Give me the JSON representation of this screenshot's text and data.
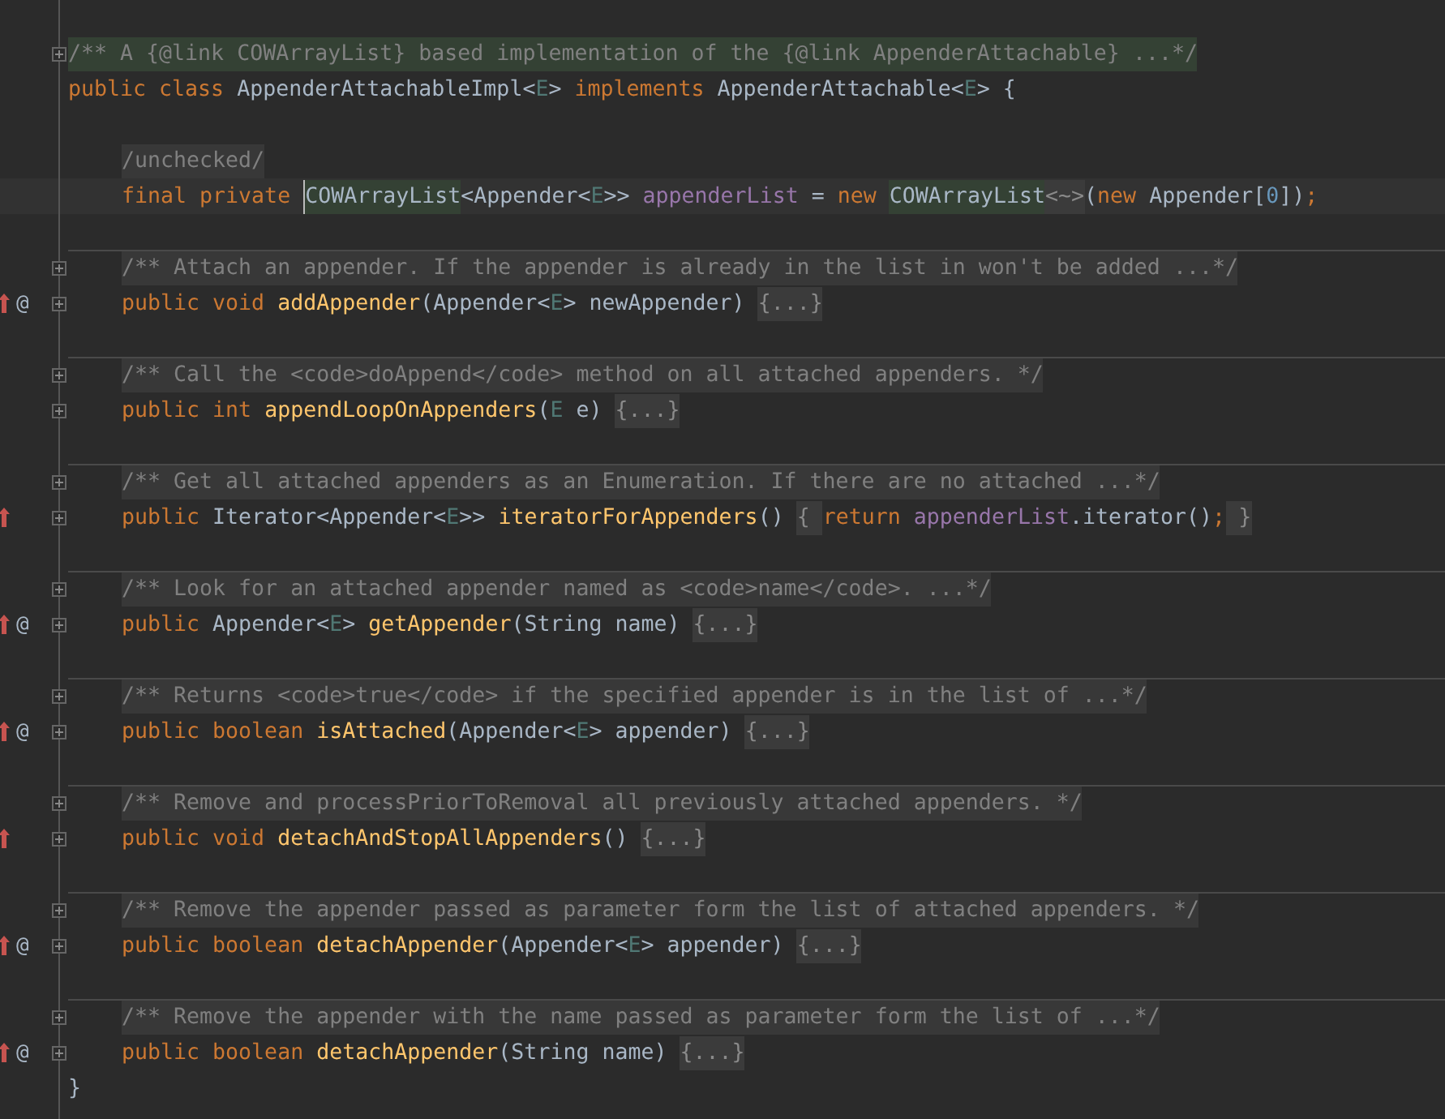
{
  "editor": {
    "lines": [
      {
        "space_before": true,
        "foldable": true,
        "tokens": [
          {
            "text": "/** A {@link COWArrayList} based implementation of the {@link AppenderAttachable} ...*/",
            "kind": "comment",
            "highlight": true
          }
        ]
      },
      {
        "tokens": [
          {
            "text": "public class ",
            "kind": "kw"
          },
          {
            "text": "AppenderAttachableImpl<",
            "kind": "plain"
          },
          {
            "text": "E",
            "kind": "tparam"
          },
          {
            "text": "> ",
            "kind": "plain"
          },
          {
            "text": "implements ",
            "kind": "kw"
          },
          {
            "text": "AppenderAttachable<",
            "kind": "plain"
          },
          {
            "text": "E",
            "kind": "tparam"
          },
          {
            "text": "> {",
            "kind": "plain"
          }
        ],
        "children": [
          {
            "space_before": true,
            "tokens": [
              {
                "text": "/unchecked/",
                "kind": "comment"
              }
            ]
          },
          {
            "current": true,
            "tokens": [
              {
                "text": "final private ",
                "kind": "kw"
              },
              {
                "text": "COWArrayList",
                "kind": "plain",
                "highlight": true,
                "caret": true
              },
              {
                "text": "<Appender<",
                "kind": "plain"
              },
              {
                "text": "E",
                "kind": "tparam"
              },
              {
                "text": ">> ",
                "kind": "plain"
              },
              {
                "text": "appenderList",
                "kind": "field"
              },
              {
                "text": " = ",
                "kind": "plain"
              },
              {
                "text": "new ",
                "kind": "kw"
              },
              {
                "text": "COWArrayList",
                "kind": "plain",
                "highlight": true
              },
              {
                "text": "<~>",
                "kind": "fold"
              },
              {
                "text": "(",
                "kind": "plain"
              },
              {
                "text": "new ",
                "kind": "kw"
              },
              {
                "text": "Appender[",
                "kind": "plain"
              },
              {
                "text": "0",
                "kind": "num"
              },
              {
                "text": "])",
                "kind": "plain"
              },
              {
                "text": ";",
                "kind": "kw"
              }
            ]
          },
          {
            "space_before": true,
            "separator": true,
            "foldable": true,
            "tokens": [
              {
                "text": "/** Attach an appender. If the appender is already in the list in won't be added ...*/",
                "kind": "comment"
              }
            ]
          },
          {
            "foldable": true,
            "override": true,
            "marker": "@",
            "tokens": [
              {
                "text": "public void ",
                "kind": "kw"
              },
              {
                "text": "addAppender",
                "kind": "method"
              },
              {
                "text": "(Appender<",
                "kind": "plain"
              },
              {
                "text": "E",
                "kind": "tparam"
              },
              {
                "text": "> newAppender) ",
                "kind": "plain"
              },
              {
                "text": "{...}",
                "kind": "fold"
              }
            ]
          },
          {
            "space_before": true,
            "separator": true,
            "foldable": true,
            "tokens": [
              {
                "text": "/** Call the <code>doAppend</code> method on all attached appenders. */",
                "kind": "comment"
              }
            ]
          },
          {
            "foldable": true,
            "tokens": [
              {
                "text": "public int ",
                "kind": "kw"
              },
              {
                "text": "appendLoopOnAppenders",
                "kind": "method"
              },
              {
                "text": "(",
                "kind": "plain"
              },
              {
                "text": "E",
                "kind": "tparam"
              },
              {
                "text": " e) ",
                "kind": "plain"
              },
              {
                "text": "{...}",
                "kind": "fold"
              }
            ]
          },
          {
            "space_before": true,
            "separator": true,
            "foldable": true,
            "tokens": [
              {
                "text": "/** Get all attached appenders as an Enumeration. If there are no attached ...*/",
                "kind": "comment"
              }
            ]
          },
          {
            "foldable": true,
            "override": true,
            "tokens": [
              {
                "text": "public ",
                "kind": "kw"
              },
              {
                "text": "Iterator<Appender<",
                "kind": "plain"
              },
              {
                "text": "E",
                "kind": "tparam"
              },
              {
                "text": ">> ",
                "kind": "plain"
              },
              {
                "text": "iteratorForAppenders",
                "kind": "method"
              },
              {
                "text": "() ",
                "kind": "plain"
              },
              {
                "text": "{ ",
                "kind": "fold"
              },
              {
                "text": "return ",
                "kind": "kw"
              },
              {
                "text": "appenderList",
                "kind": "field"
              },
              {
                "text": ".iterator()",
                "kind": "plain"
              },
              {
                "text": ";",
                "kind": "kw"
              },
              {
                "text": " }",
                "kind": "fold"
              }
            ]
          },
          {
            "space_before": true,
            "separator": true,
            "foldable": true,
            "tokens": [
              {
                "text": "/** Look for an attached appender named as <code>name</code>. ...*/",
                "kind": "comment"
              }
            ]
          },
          {
            "foldable": true,
            "override": true,
            "marker": "@",
            "tokens": [
              {
                "text": "public ",
                "kind": "kw"
              },
              {
                "text": "Appender<",
                "kind": "plain"
              },
              {
                "text": "E",
                "kind": "tparam"
              },
              {
                "text": "> ",
                "kind": "plain"
              },
              {
                "text": "getAppender",
                "kind": "method"
              },
              {
                "text": "(String name) ",
                "kind": "plain"
              },
              {
                "text": "{...}",
                "kind": "fold"
              }
            ]
          },
          {
            "space_before": true,
            "separator": true,
            "foldable": true,
            "tokens": [
              {
                "text": "/** Returns <code>true</code> if the specified appender is in the list of ...*/",
                "kind": "comment"
              }
            ]
          },
          {
            "foldable": true,
            "override": true,
            "marker": "@",
            "tokens": [
              {
                "text": "public boolean ",
                "kind": "kw"
              },
              {
                "text": "isAttached",
                "kind": "method"
              },
              {
                "text": "(Appender<",
                "kind": "plain"
              },
              {
                "text": "E",
                "kind": "tparam"
              },
              {
                "text": "> appender) ",
                "kind": "plain"
              },
              {
                "text": "{...}",
                "kind": "fold"
              }
            ]
          },
          {
            "space_before": true,
            "separator": true,
            "foldable": true,
            "tokens": [
              {
                "text": "/** Remove and processPriorToRemoval all previously attached appenders. */",
                "kind": "comment"
              }
            ]
          },
          {
            "foldable": true,
            "override": true,
            "tokens": [
              {
                "text": "public void ",
                "kind": "kw"
              },
              {
                "text": "detachAndStopAllAppenders",
                "kind": "method"
              },
              {
                "text": "() ",
                "kind": "plain"
              },
              {
                "text": "{...}",
                "kind": "fold"
              }
            ]
          },
          {
            "space_before": true,
            "separator": true,
            "foldable": true,
            "tokens": [
              {
                "text": "/** Remove the appender passed as parameter form the list of attached appenders. */",
                "kind": "comment"
              }
            ]
          },
          {
            "foldable": true,
            "override": true,
            "marker": "@",
            "tokens": [
              {
                "text": "public boolean ",
                "kind": "kw"
              },
              {
                "text": "detachAppender",
                "kind": "method"
              },
              {
                "text": "(Appender<",
                "kind": "plain"
              },
              {
                "text": "E",
                "kind": "tparam"
              },
              {
                "text": "> appender) ",
                "kind": "plain"
              },
              {
                "text": "{...}",
                "kind": "fold"
              }
            ]
          },
          {
            "space_before": true,
            "separator": true,
            "foldable": true,
            "tokens": [
              {
                "text": "/** Remove the appender with the name passed as parameter form the list of ...*/",
                "kind": "comment"
              }
            ]
          },
          {
            "foldable": true,
            "override": true,
            "marker": "@",
            "tokens": [
              {
                "text": "public boolean ",
                "kind": "kw"
              },
              {
                "text": "detachAppender",
                "kind": "method"
              },
              {
                "text": "(String name) ",
                "kind": "plain"
              },
              {
                "text": "{...}",
                "kind": "fold"
              }
            ]
          }
        ]
      },
      {
        "tokens": [
          {
            "text": "}",
            "kind": "plain"
          }
        ]
      }
    ]
  }
}
